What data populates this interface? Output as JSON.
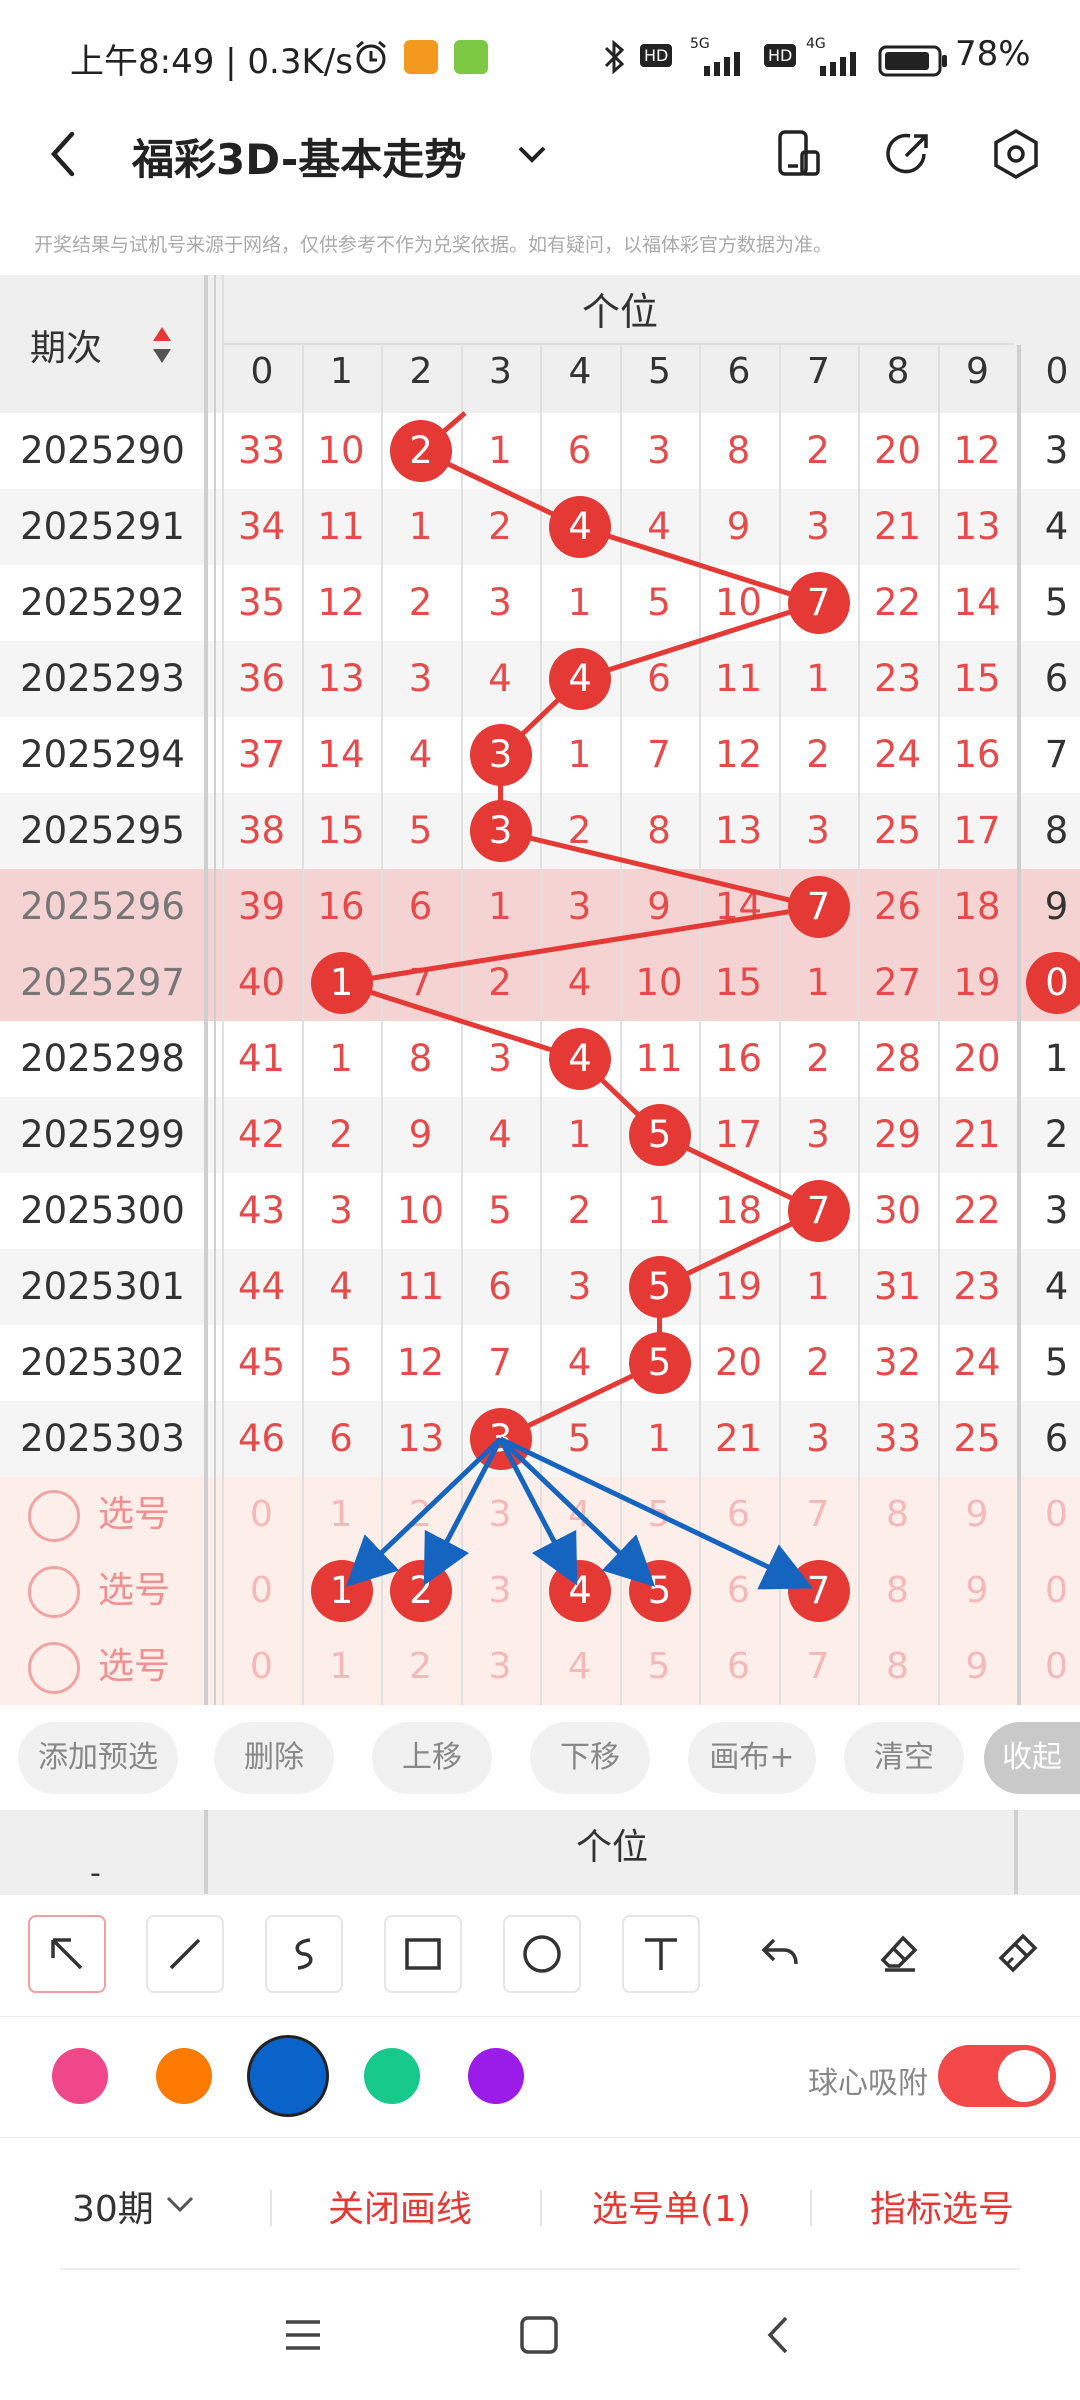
{
  "status_bar": {
    "time": "上午8:49 | 0.3K/s",
    "net1": "5G",
    "net2": "4G",
    "hd": "HD",
    "battery": "78%"
  },
  "header": {
    "back_icon": "chevron-left-icon",
    "title": "福彩3D-基本走势",
    "dropdown_icon": "chevron-down-icon",
    "action_icons": [
      "phone-layout-icon",
      "share-icon",
      "settings-icon"
    ]
  },
  "disclaimer": "开奖结果与试机号来源于网络，仅供参考不作为兑奖依据。如有疑问，以福体彩官方数据为准。",
  "table": {
    "period_header": "期次",
    "group_header": "个位",
    "digit_headers": [
      "0",
      "1",
      "2",
      "3",
      "4",
      "5",
      "6",
      "7",
      "8",
      "9"
    ],
    "extra_header": "0",
    "rows": [
      {
        "period": "2025290",
        "cells": [
          "33",
          "10",
          "2",
          "1",
          "6",
          "3",
          "8",
          "2",
          "20",
          "12"
        ],
        "hit": 2,
        "extra": "3",
        "highlight": false
      },
      {
        "period": "2025291",
        "cells": [
          "34",
          "11",
          "1",
          "2",
          "4",
          "4",
          "9",
          "3",
          "21",
          "13"
        ],
        "hit": 4,
        "extra": "4",
        "highlight": false
      },
      {
        "period": "2025292",
        "cells": [
          "35",
          "12",
          "2",
          "3",
          "1",
          "5",
          "10",
          "7",
          "22",
          "14"
        ],
        "hit": 7,
        "extra": "5",
        "highlight": false
      },
      {
        "period": "2025293",
        "cells": [
          "36",
          "13",
          "3",
          "4",
          "4",
          "6",
          "11",
          "1",
          "23",
          "15"
        ],
        "hit": 4,
        "extra": "6",
        "highlight": false
      },
      {
        "period": "2025294",
        "cells": [
          "37",
          "14",
          "4",
          "3",
          "1",
          "7",
          "12",
          "2",
          "24",
          "16"
        ],
        "hit": 3,
        "extra": "7",
        "highlight": false
      },
      {
        "period": "2025295",
        "cells": [
          "38",
          "15",
          "5",
          "3",
          "2",
          "8",
          "13",
          "3",
          "25",
          "17"
        ],
        "hit": 3,
        "extra": "8",
        "highlight": false
      },
      {
        "period": "2025296",
        "cells": [
          "39",
          "16",
          "6",
          "1",
          "3",
          "9",
          "14",
          "7",
          "26",
          "18"
        ],
        "hit": 7,
        "extra": "9",
        "highlight": true
      },
      {
        "period": "2025297",
        "cells": [
          "40",
          "1",
          "7",
          "2",
          "4",
          "10",
          "15",
          "1",
          "27",
          "19"
        ],
        "hit": 1,
        "extra": "0",
        "extra_hit": true,
        "highlight": true
      },
      {
        "period": "2025298",
        "cells": [
          "41",
          "1",
          "8",
          "3",
          "4",
          "11",
          "16",
          "2",
          "28",
          "20"
        ],
        "hit": 4,
        "extra": "1",
        "highlight": false
      },
      {
        "period": "2025299",
        "cells": [
          "42",
          "2",
          "9",
          "4",
          "1",
          "5",
          "17",
          "3",
          "29",
          "21"
        ],
        "hit": 5,
        "extra": "2",
        "highlight": false
      },
      {
        "period": "2025300",
        "cells": [
          "43",
          "3",
          "10",
          "5",
          "2",
          "1",
          "18",
          "7",
          "30",
          "22"
        ],
        "hit": 7,
        "extra": "3",
        "highlight": false
      },
      {
        "period": "2025301",
        "cells": [
          "44",
          "4",
          "11",
          "6",
          "3",
          "5",
          "19",
          "1",
          "31",
          "23"
        ],
        "hit": 5,
        "extra": "4",
        "highlight": false
      },
      {
        "period": "2025302",
        "cells": [
          "45",
          "5",
          "12",
          "7",
          "4",
          "5",
          "20",
          "2",
          "32",
          "24"
        ],
        "hit": 5,
        "extra": "5",
        "highlight": false
      },
      {
        "period": "2025303",
        "cells": [
          "46",
          "6",
          "13",
          "3",
          "5",
          "1",
          "21",
          "3",
          "33",
          "25"
        ],
        "hit": 3,
        "extra": "6",
        "highlight": false
      }
    ],
    "select_rows": [
      {
        "label": "选号",
        "digits": [
          "0",
          "1",
          "2",
          "3",
          "4",
          "5",
          "6",
          "7",
          "8",
          "9"
        ],
        "extra": "0",
        "picked": []
      },
      {
        "label": "选号",
        "digits": [
          "0",
          "1",
          "2",
          "3",
          "4",
          "5",
          "6",
          "7",
          "8",
          "9"
        ],
        "extra": "0",
        "picked": [
          1,
          2,
          4,
          5,
          7
        ]
      },
      {
        "label": "选号",
        "digits": [
          "0",
          "1",
          "2",
          "3",
          "4",
          "5",
          "6",
          "7",
          "8",
          "9"
        ],
        "extra": "0",
        "picked": []
      }
    ]
  },
  "actions": [
    "添加预选",
    "删除",
    "上移",
    "下移",
    "画布+",
    "清空",
    "收起"
  ],
  "second_header": {
    "group": "个位",
    "left": "-"
  },
  "tools": [
    "arrow-tool-icon",
    "line-tool-icon",
    "curve-tool-icon",
    "rectangle-tool-icon",
    "circle-tool-icon",
    "text-tool-icon",
    "undo-icon",
    "eraser-icon",
    "clear-brush-icon"
  ],
  "colors": [
    "#f0468a",
    "#ff7a00",
    "#0a63c9",
    "#18c98c",
    "#9b1be8"
  ],
  "selected_color": "#0a63c9",
  "snap_label": "球心吸附",
  "snap_on": true,
  "bottom": {
    "period_select": "30期",
    "close_lines": "关闭画线",
    "pick_list": "选号单(1)",
    "indicator": "指标选号"
  },
  "nav_icons": [
    "menu-icon",
    "home-icon",
    "back-icon"
  ]
}
